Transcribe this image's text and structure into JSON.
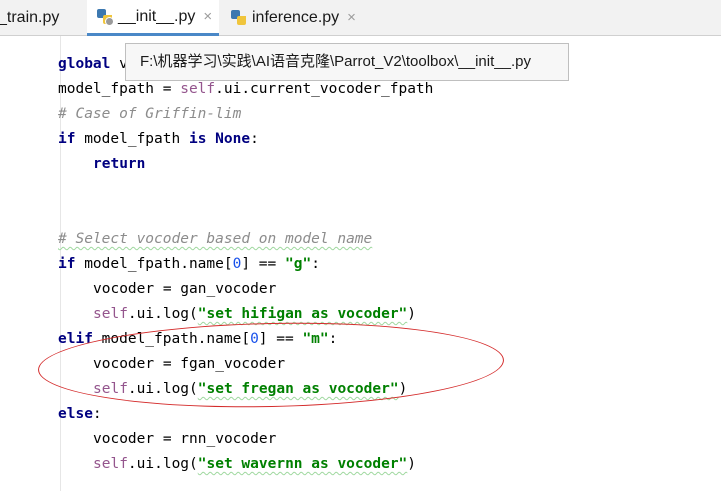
{
  "tabs": [
    {
      "label": "_train.py",
      "active": false
    },
    {
      "label": "__init__.py",
      "active": true,
      "close": "×"
    },
    {
      "label": "inference.py",
      "active": false,
      "close": "×"
    }
  ],
  "tooltip": {
    "path": "F:\\机器学习\\实践\\AI语音克隆\\Parrot_V2\\toolbox\\__init__.py"
  },
  "code": {
    "l1": {
      "kw": "global",
      "rest": " v"
    },
    "l2": {
      "a": "model_fpath = ",
      "self": "self",
      "b": ".ui.current_vocoder_fpath"
    },
    "l3": {
      "comment": "# Case of Griffin-lim"
    },
    "l4": {
      "kw1": "if",
      "a": " model_fpath ",
      "kw2": "is",
      "sp": " ",
      "kw3": "None",
      "b": ":"
    },
    "l5": {
      "kw": "return"
    },
    "l6": {
      "comment": "# Select vocoder based on model name"
    },
    "l7": {
      "kw": "if",
      "a": " model_fpath.name[",
      "num": "0",
      "b": "] == ",
      "str": "\"g\"",
      "c": ":"
    },
    "l8": {
      "text": "vocoder = gan_vocoder"
    },
    "l9": {
      "self": "self",
      "a": ".ui.log(",
      "str": "\"set hifigan as vocoder\"",
      "b": ")"
    },
    "l10": {
      "kw": "elif",
      "a": " model_fpath.name[",
      "num": "0",
      "b": "] == ",
      "str": "\"m\"",
      "c": ":"
    },
    "l11": {
      "text": "vocoder = fgan_vocoder"
    },
    "l12": {
      "self": "self",
      "a": ".ui.log(",
      "str": "\"set fregan as vocoder\"",
      "b": ")"
    },
    "l13": {
      "kw": "else",
      "a": ":"
    },
    "l14": {
      "text": "vocoder = rnn_vocoder"
    },
    "l15": {
      "self": "self",
      "a": ".ui.log(",
      "str": "\"set wavernn as vocoder\"",
      "b": ")"
    }
  },
  "annotation": {
    "color": "#d42b2b",
    "shape": "ellipse"
  }
}
